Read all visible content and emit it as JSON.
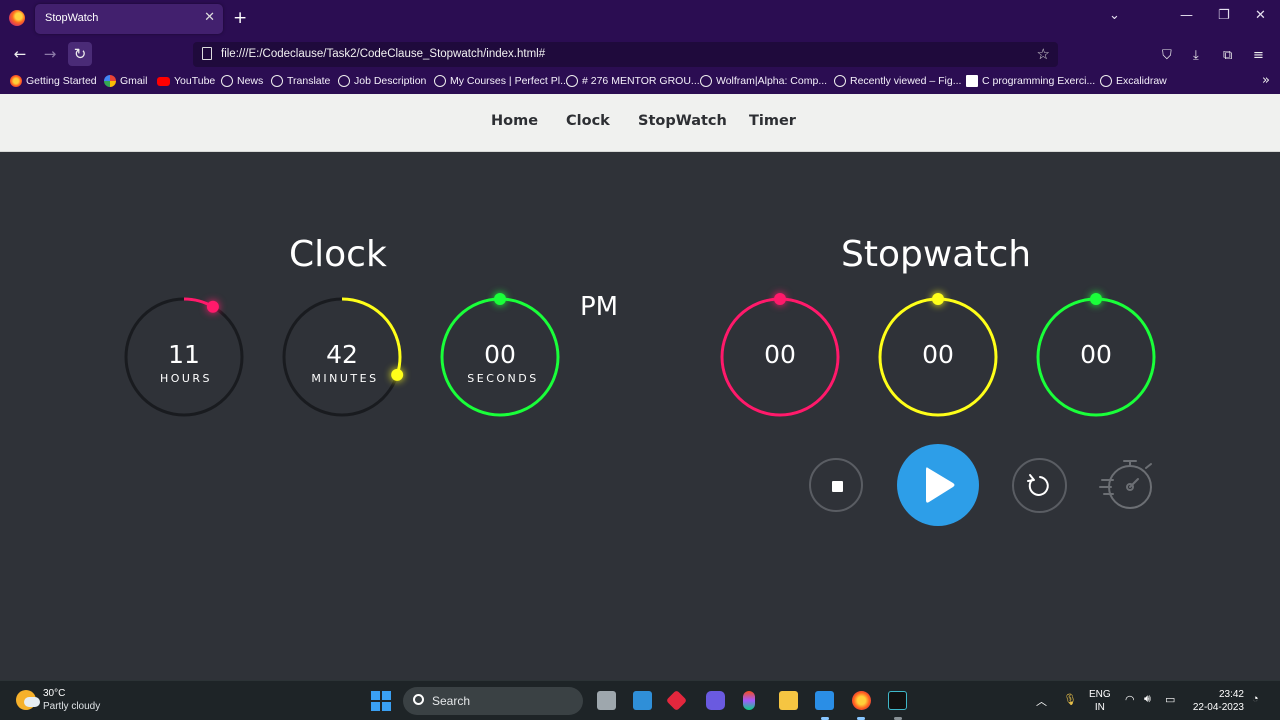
{
  "browser": {
    "tab_title": "StopWatch",
    "url": "file:///E:/Codeclause/Task2/CodeClause_Stopwatch/index.html#",
    "bookmarks": [
      {
        "label": "Getting Started",
        "icon": "firefox-icon"
      },
      {
        "label": "Gmail",
        "icon": "google-icon"
      },
      {
        "label": "YouTube",
        "icon": "youtube-icon"
      },
      {
        "label": "News",
        "icon": "globe-icon"
      },
      {
        "label": "Translate",
        "icon": "globe-icon"
      },
      {
        "label": "Job Description",
        "icon": "globe-icon"
      },
      {
        "label": "My Courses | Perfect Pl...",
        "icon": "globe-icon"
      },
      {
        "label": "# 276 MENTOR GROU...",
        "icon": "globe-icon"
      },
      {
        "label": "Wolfram|Alpha: Comp...",
        "icon": "globe-icon"
      },
      {
        "label": "Recently viewed – Fig...",
        "icon": "globe-icon"
      },
      {
        "label": "C programming Exerci...",
        "icon": "site-icon"
      },
      {
        "label": "Excalidraw",
        "icon": "globe-icon"
      }
    ]
  },
  "nav": {
    "items": [
      "Home",
      "Clock",
      "StopWatch",
      "Timer"
    ]
  },
  "clock": {
    "title": "Clock",
    "hours": {
      "value": "11",
      "label": "HOURS",
      "color": "#ff1a6b",
      "fraction": 0.917
    },
    "minutes": {
      "value": "42",
      "label": "MINUTES",
      "color": "#ffff1a",
      "fraction": 0.7
    },
    "seconds": {
      "value": "00",
      "label": "SECONDS",
      "color": "#1aff3a",
      "fraction": 0
    },
    "ampm": "PM"
  },
  "stopwatch": {
    "title": "Stopwatch",
    "hours": {
      "value": "00",
      "color": "#ff1a6b"
    },
    "minutes": {
      "value": "00",
      "color": "#ffff1a"
    },
    "seconds": {
      "value": "00",
      "color": "#1aff3a"
    },
    "controls": [
      "stop-icon",
      "play-icon",
      "reset-icon",
      "lap-stopwatch-icon"
    ],
    "accent": "#2d9ee8"
  },
  "taskbar": {
    "weather_temp": "30°C",
    "weather_desc": "Partly cloudy",
    "search_label": "Search",
    "lang_top": "ENG",
    "lang_bottom": "IN",
    "time": "23:42",
    "date": "22-04-2023"
  }
}
